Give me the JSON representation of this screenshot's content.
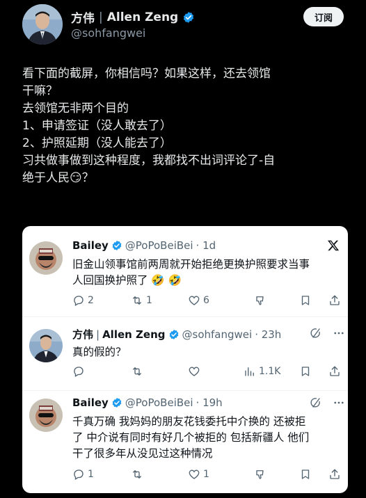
{
  "header": {
    "name": "方伟",
    "separator": "|",
    "english_name": "Allen Zeng",
    "handle": "@sohfangwei",
    "subscribe_label": "订阅"
  },
  "tweet": {
    "lines": [
      "看下面的截屏，你相信吗？如果这样，还去领馆",
      "干嘛？",
      "去领馆无非两个目的",
      "1、申请签证（没人敢去了）",
      "2、护照延期（没人能去了）",
      "习共做事做到这种程度，我都找不出词评论了-自",
      "绝于人民😏？"
    ]
  },
  "card": {
    "replies": [
      {
        "name": "Bailey",
        "handle": "@PoPoBeiBei",
        "time": "· 1d",
        "lines": [
          "旧金山领事馆前两周就开始拒绝更换护照要求当事",
          "人回国换护照了 🤣 🤣"
        ],
        "replies": "2",
        "reposts": "1",
        "likes": "6",
        "views": ""
      },
      {
        "name": "方伟",
        "separator": "|",
        "english_name": "Allen Zeng",
        "handle": "@sohfangwei",
        "time": "· 23h",
        "lines": [
          "真的假的？"
        ],
        "replies": "",
        "reposts": "",
        "likes": "",
        "views": "1.1K"
      },
      {
        "name": "Bailey",
        "handle": "@PoPoBeiBei",
        "time": "· 19h",
        "lines": [
          "千真万确 我妈妈的朋友花钱委托中介换的 还被拒",
          "了 中介说有同时有好几个被拒的 包括新疆人 他们",
          "干了很多年从没见过这种情况"
        ],
        "replies": "1",
        "reposts": "",
        "likes": "1",
        "views": ""
      }
    ]
  },
  "colors": {
    "background": "#000000",
    "text": "#e7e9ea",
    "muted": "#8b98a5",
    "verified": "#1d9bf0",
    "card_bg": "#ffffff",
    "card_muted": "#536471"
  }
}
